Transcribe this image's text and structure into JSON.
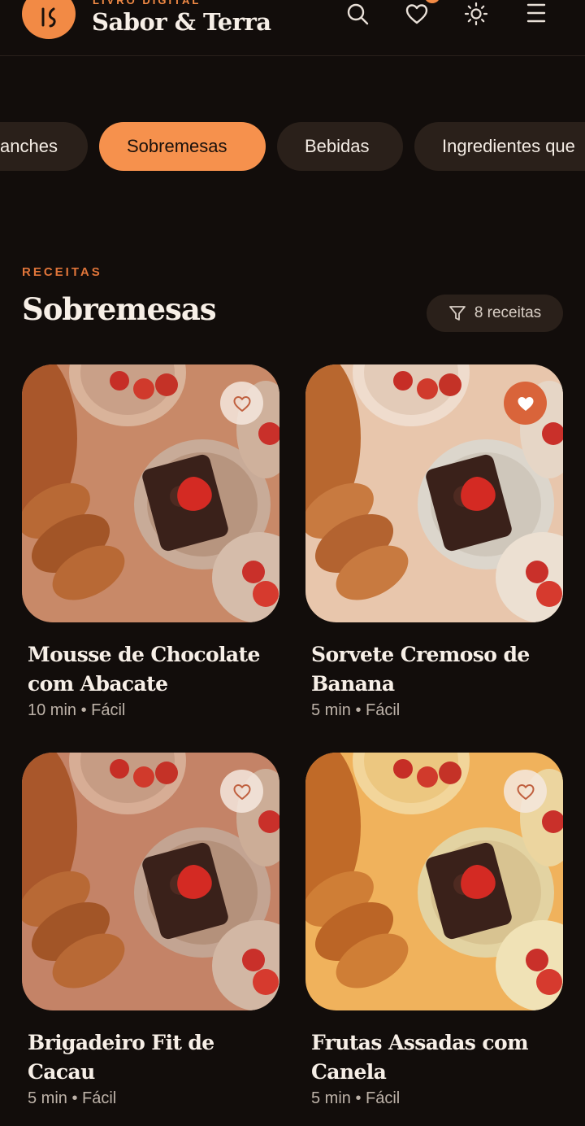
{
  "header": {
    "kicker": "LIVRO DIGITAL",
    "brand": "Sabor & Terra",
    "icons": [
      "search-icon",
      "heart-icon",
      "sun-icon",
      "menu-icon"
    ]
  },
  "categories": [
    {
      "label": "Lanches",
      "visible_text": "anches",
      "active": false
    },
    {
      "label": "Sobremesas",
      "active": true
    },
    {
      "label": "Bebidas",
      "active": false
    },
    {
      "label": "Ingredientes que",
      "visible_text": "Ingredientes que",
      "active": false
    }
  ],
  "section": {
    "kicker": "RECEITAS",
    "title": "Sobremesas",
    "count_label": "8 receitas"
  },
  "recipes": [
    {
      "title": "Mousse de Chocolate com Abacate",
      "meta": "10 min • Fácil",
      "favorite": false
    },
    {
      "title": "Sorvete Cremoso de Banana",
      "meta": "5 min • Fácil",
      "favorite": true
    },
    {
      "title": "Brigadeiro Fit de Cacau",
      "meta": "5 min • Fácil",
      "favorite": false
    },
    {
      "title": "Frutas Assadas com Canela",
      "meta": "5 min • Fácil",
      "favorite": false
    }
  ],
  "colors": {
    "background": "#120d0b",
    "accent": "#f28a45",
    "chip": "#2a201a"
  }
}
